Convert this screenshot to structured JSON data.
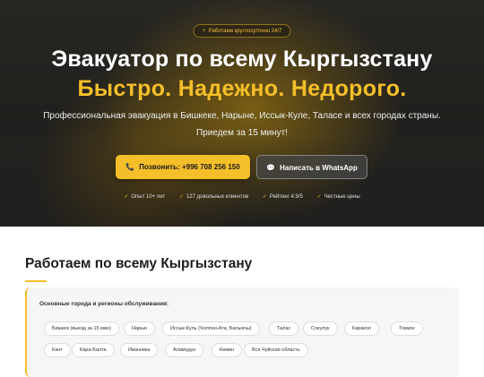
{
  "hero": {
    "badge": "Работаем круглосуточно 24/7",
    "badge_icon": "lightning-icon",
    "title_line1": "Эвакуатор по всему Кыргызстану",
    "title_line2": "Быстро. Надежно. Недорого.",
    "subtitle_line1": "Профессиональная эвакуация в Бишкеке, Нарыне, Иссык-Куле, Таласе и всех городах страны.",
    "subtitle_line2": "Приедем за 15 минут!",
    "call_button": "Позвонить: +996 708 256 150",
    "call_icon": "phone-icon",
    "whatsapp_button": "Написать в WhatsApp",
    "whatsapp_icon": "chat-icon",
    "features": [
      "Опыт 10+ лет",
      "127 довольных клиентов",
      "Рейтинг 4.9/5",
      "Честные цены"
    ]
  },
  "colors": {
    "accent": "#f5bf2a",
    "hero_overlay": "#2b2a27",
    "text_dark": "#1d1d1d",
    "card_bg": "#f6f6f6"
  },
  "coverage": {
    "title": "Работаем по всему Кыргызстану",
    "card_title": "Основные города и регионы обслуживания:",
    "cities_row1": [
      "Бишкек (выезд за 15 мин)",
      "Нарын",
      "Иссык-Куль (Чолпон-Ата, Балыкчы)",
      "Талас",
      "Сокулук",
      "Каракол",
      "Токмок"
    ],
    "cities_row2": [
      "Кант",
      "Кара-Балта",
      "Ивановка",
      "Аламүдүн",
      "Кемин",
      "Вся Чуйская область"
    ]
  }
}
